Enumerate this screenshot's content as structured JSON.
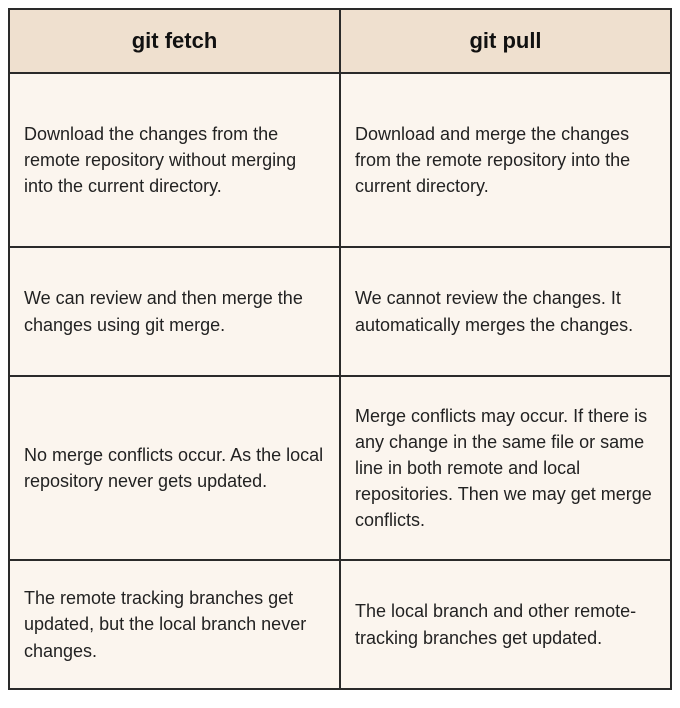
{
  "table": {
    "header": {
      "col1": "git fetch",
      "col2": "git pull"
    },
    "rows": [
      {
        "col1": "Download the changes from the remote repository without merging into the current directory.",
        "col2": "Download and merge the changes from the remote repository into the current directory."
      },
      {
        "col1": "We can review and then merge the changes using git merge.",
        "col2": "We cannot review the changes. It automatically merges the changes."
      },
      {
        "col1": "No merge conflicts occur. As the local repository never gets updated.",
        "col2": "Merge conflicts may occur. If there is any change in the same file or same line in both remote and local repositories. Then we may get merge conflicts."
      },
      {
        "col1": "The remote tracking branches get updated, but the local branch never changes.",
        "col2": "The local branch and other remote-tracking branches get updated."
      }
    ]
  }
}
